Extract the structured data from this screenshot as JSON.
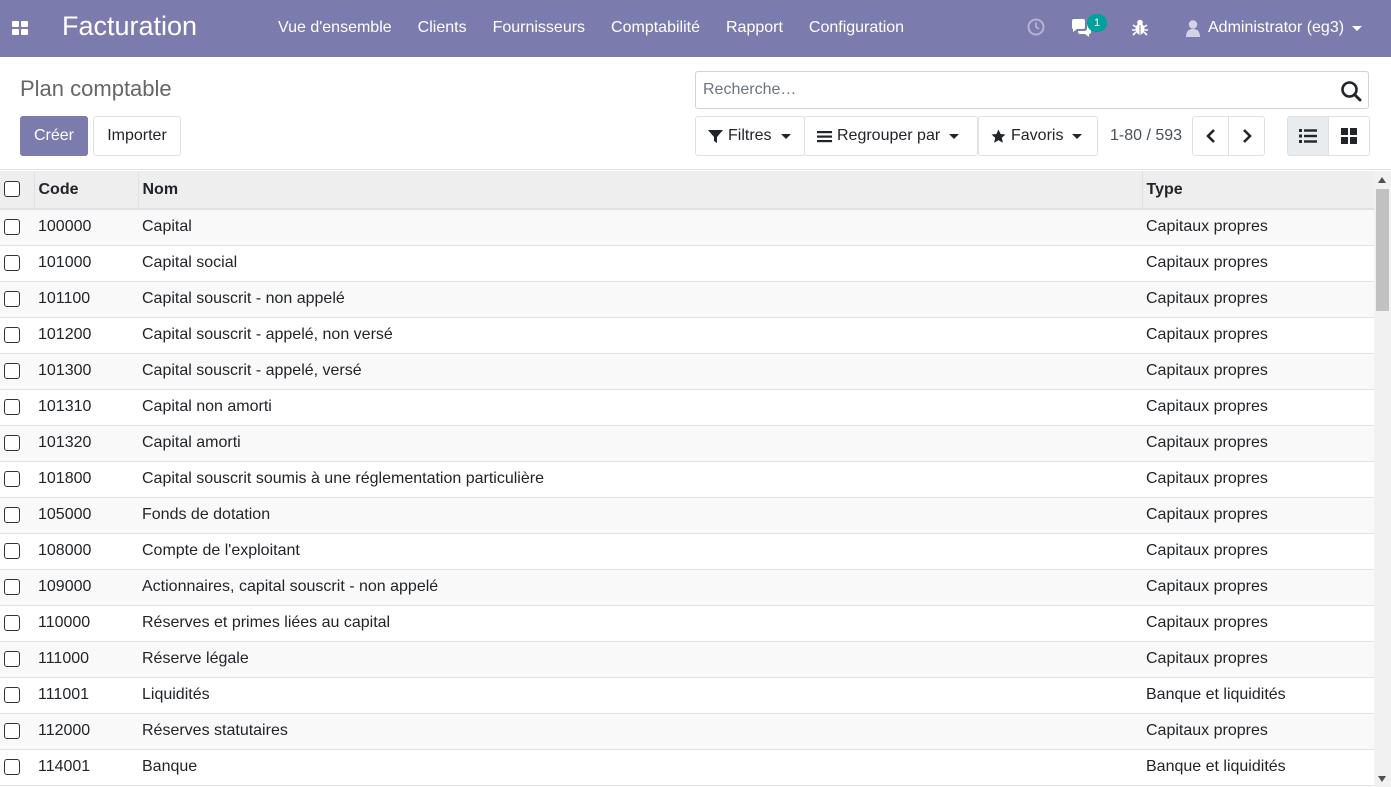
{
  "navbar": {
    "app_name": "Facturation",
    "menu": [
      "Vue d'ensemble",
      "Clients",
      "Fournisseurs",
      "Comptabilité",
      "Rapport",
      "Configuration"
    ],
    "chat_badge": "1",
    "user_name": "Administrator (eg3)",
    "bg_color": "#7c7bad",
    "icons": [
      "apps-icon",
      "clock-icon",
      "chat-icon",
      "bug-icon",
      "user-icon"
    ]
  },
  "control_panel": {
    "title": "Plan comptable",
    "create_label": "Créer",
    "import_label": "Importer",
    "search_placeholder": "Recherche…",
    "filters_label": "Filtres",
    "group_label": "Regrouper par",
    "favorites_label": "Favoris",
    "pager": "1-80 / 593"
  },
  "table": {
    "headers": {
      "code": "Code",
      "name": "Nom",
      "type": "Type"
    },
    "rows": [
      {
        "code": "100000",
        "name": "Capital",
        "type": "Capitaux propres"
      },
      {
        "code": "101000",
        "name": "Capital social",
        "type": "Capitaux propres"
      },
      {
        "code": "101100",
        "name": "Capital souscrit - non appelé",
        "type": "Capitaux propres"
      },
      {
        "code": "101200",
        "name": "Capital souscrit - appelé, non versé",
        "type": "Capitaux propres"
      },
      {
        "code": "101300",
        "name": "Capital souscrit - appelé, versé",
        "type": "Capitaux propres"
      },
      {
        "code": "101310",
        "name": "Capital non amorti",
        "type": "Capitaux propres"
      },
      {
        "code": "101320",
        "name": "Capital amorti",
        "type": "Capitaux propres"
      },
      {
        "code": "101800",
        "name": "Capital souscrit soumis à une réglementation particulière",
        "type": "Capitaux propres"
      },
      {
        "code": "105000",
        "name": "Fonds de dotation",
        "type": "Capitaux propres"
      },
      {
        "code": "108000",
        "name": "Compte de l'exploitant",
        "type": "Capitaux propres"
      },
      {
        "code": "109000",
        "name": "Actionnaires, capital souscrit - non appelé",
        "type": "Capitaux propres"
      },
      {
        "code": "110000",
        "name": "Réserves et primes liées au capital",
        "type": "Capitaux propres"
      },
      {
        "code": "111000",
        "name": "Réserve légale",
        "type": "Capitaux propres"
      },
      {
        "code": "111001",
        "name": "Liquidités",
        "type": "Banque et liquidités"
      },
      {
        "code": "112000",
        "name": "Réserves statutaires",
        "type": "Capitaux propres"
      },
      {
        "code": "114001",
        "name": "Banque",
        "type": "Banque et liquidités"
      }
    ]
  }
}
